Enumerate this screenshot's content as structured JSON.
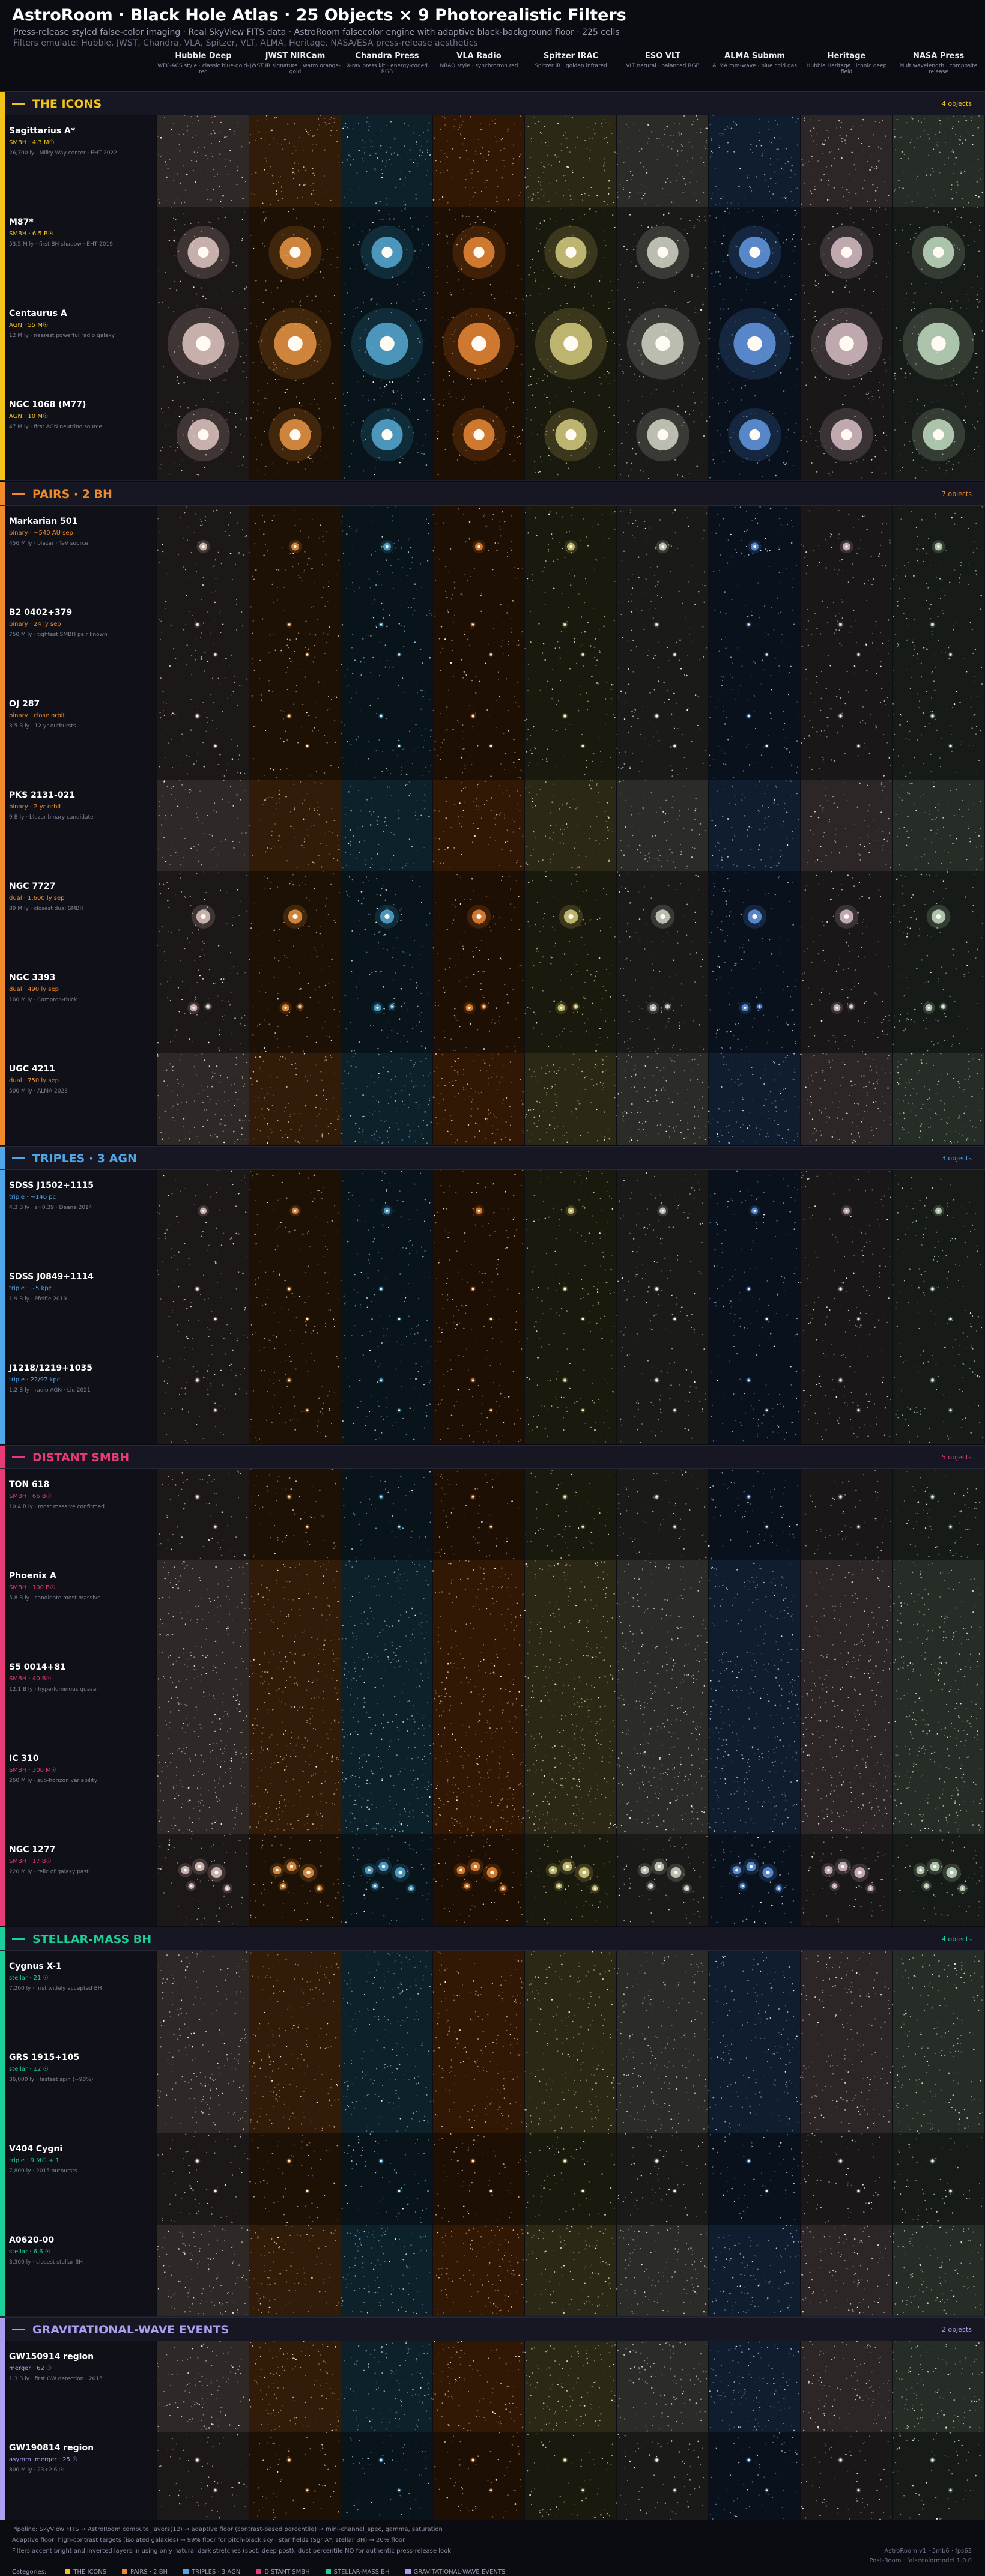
{
  "header": {
    "title": "AstroRoom · Black Hole Atlas · 25 Objects × 9 Photorealistic Filters",
    "subtitle": "Press-release styled false-color imaging · Real SkyView FITS data · AstroRoom falsecolor engine with adaptive black-background floor · 225 cells",
    "subtitle2": "Filters emulate: Hubble, JWST, Chandra, VLA, Spitzer, VLT, ALMA, Heritage, NASA/ESA press-release aesthetics"
  },
  "columns": [
    {
      "name": "Hubble Deep",
      "sub": "WFC-ACS style · classic blue-gold-red",
      "tint": "#e6c7c2"
    },
    {
      "name": "JWST NIRCam",
      "sub": "JWST IR signature · warm orange-gold",
      "tint": "#f08a2a"
    },
    {
      "name": "Chandra Press",
      "sub": "X-ray press kit · energy-coded RGB",
      "tint": "#3fa4d6"
    },
    {
      "name": "VLA Radio",
      "sub": "NRAO style · synchrotron red",
      "tint": "#f07a18"
    },
    {
      "name": "Spitzer IRAC",
      "sub": "Spitzer IR · golden infrared",
      "tint": "#d9cd6e"
    },
    {
      "name": "ESO VLT",
      "sub": "VLT natural · balanced RGB",
      "tint": "#d6d8c6"
    },
    {
      "name": "ALMA Submm",
      "sub": "ALMA mm-wave · blue cold gas",
      "tint": "#4d8fe8"
    },
    {
      "name": "Heritage",
      "sub": "Hubble Heritage · iconic deep field",
      "tint": "#dcbcc4"
    },
    {
      "name": "NASA Press",
      "sub": "Multiwavelength · composite release",
      "tint": "#bfe2bf"
    }
  ],
  "sections": [
    {
      "title": "THE ICONS",
      "count": "4 objects",
      "color": "#f2c318",
      "rows": [
        {
          "name": "Sagittarius A*",
          "type": "SMBH · 4.3 M☉",
          "note": "26,700 ly · Milky Way center · EHT 2022",
          "morph": "field",
          "noise": 0.9
        },
        {
          "name": "M87*",
          "type": "SMBH · 6.5 B☉",
          "note": "53.5 M ly · first BH shadow · EHT 2019",
          "morph": "galaxy",
          "size": 1.0
        },
        {
          "name": "Centaurus A",
          "type": "AGN · 55 M☉",
          "note": "12 M ly · nearest powerful radio galaxy",
          "morph": "galaxy",
          "size": 1.35
        },
        {
          "name": "NGC 1068 (M77)",
          "type": "AGN · 10 M☉",
          "note": "47 M ly · first AGN neutrino source",
          "morph": "galaxy",
          "size": 1.0
        }
      ]
    },
    {
      "title": "PAIRS · 2 BH",
      "count": "7 objects",
      "color": "#f08a2a",
      "rows": [
        {
          "name": "Markarian 501",
          "type": "binary · ~540 AU sep",
          "note": "456 M ly · blazar · TeV source",
          "morph": "point",
          "size": 0.35
        },
        {
          "name": "B2 0402+379",
          "type": "binary · 24 ly sep",
          "note": "750 M ly · tightest SMBH pair known",
          "morph": "sparse",
          "size": 0.25
        },
        {
          "name": "OJ 287",
          "type": "binary · close orbit",
          "note": "3.5 B ly · 12 yr outbursts",
          "morph": "sparse",
          "size": 0.2
        },
        {
          "name": "PKS 2131-021",
          "type": "binary · 2 yr orbit",
          "note": "9 B ly · blazar binary candidate",
          "morph": "field",
          "noise": 0.7
        },
        {
          "name": "NGC 7727",
          "type": "dual · 1,600 ly sep",
          "note": "89 M ly · closest dual SMBH",
          "morph": "galaxy",
          "size": 0.45
        },
        {
          "name": "NGC 3393",
          "type": "dual · 490 ly sep",
          "note": "160 M ly · Compton-thick",
          "morph": "double",
          "size": 0.3
        },
        {
          "name": "UGC 4211",
          "type": "dual · 750 ly sep",
          "note": "500 M ly · ALMA 2023",
          "morph": "field",
          "noise": 1.0
        }
      ]
    },
    {
      "title": "TRIPLES · 3 AGN",
      "count": "3 objects",
      "color": "#4fa6e8",
      "rows": [
        {
          "name": "SDSS J1502+1115",
          "type": "triple · ~140 pc",
          "note": "4.3 B ly · z=0.39 · Deane 2014",
          "morph": "point",
          "size": 0.25
        },
        {
          "name": "SDSS J0849+1114",
          "type": "triple · ~5 kpc",
          "note": "1.9 B ly · Pfeifle 2019",
          "morph": "sparse",
          "size": 0.2
        },
        {
          "name": "J1218/1219+1035",
          "type": "triple · 22/97 kpc",
          "note": "1.2 B ly · radio AGN · Liu 2021",
          "morph": "sparse",
          "size": 0.2
        }
      ]
    },
    {
      "title": "DISTANT SMBH",
      "count": "5 objects",
      "color": "#e83a74",
      "rows": [
        {
          "name": "TON 618",
          "type": "SMBH · 66 B☉",
          "note": "10.4 B ly · most massive confirmed",
          "morph": "sparse",
          "size": 0.2
        },
        {
          "name": "Phoenix A",
          "type": "SMBH · 100 B☉",
          "note": "5.8 B ly · candidate most massive",
          "morph": "field",
          "noise": 0.8
        },
        {
          "name": "S5 0014+81",
          "type": "SMBH · 40 B☉",
          "note": "12.1 B ly · hyperluminous quasar",
          "morph": "field",
          "noise": 1.1
        },
        {
          "name": "IC 310",
          "type": "SMBH · 300 M☉",
          "note": "260 M ly · sub-horizon variability",
          "morph": "field",
          "noise": 1.2
        },
        {
          "name": "NGC 1277",
          "type": "SMBH · 17 B☉",
          "note": "220 M ly · relic of galaxy past",
          "morph": "cluster",
          "size": 0.4
        }
      ]
    },
    {
      "title": "STELLAR-MASS BH",
      "count": "4 objects",
      "color": "#1ad09a",
      "rows": [
        {
          "name": "Cygnus X-1",
          "type": "stellar · 21 ☉",
          "note": "7,200 ly · first widely accepted BH",
          "morph": "field",
          "noise": 0.8
        },
        {
          "name": "GRS 1915+105",
          "type": "stellar · 12 ☉",
          "note": "36,000 ly · fastest spin (~98%)",
          "morph": "field",
          "noise": 0.9
        },
        {
          "name": "V404 Cygni",
          "type": "triple · 9 M☉ + 1",
          "note": "7,800 ly · 2015 outbursts",
          "morph": "sparse",
          "size": 0.15
        },
        {
          "name": "A0620-00",
          "type": "stellar · 6.6 ☉",
          "note": "3,300 ly · closest stellar BH",
          "morph": "field",
          "noise": 1.0
        }
      ]
    },
    {
      "title": "GRAVITATIONAL-WAVE EVENTS",
      "count": "2 objects",
      "color": "#a99ff0",
      "rows": [
        {
          "name": "GW150914 region",
          "type": "merger · 62 ☉",
          "note": "1.3 B ly · first GW detection · 2015",
          "morph": "field",
          "noise": 1.0
        },
        {
          "name": "GW190814 region",
          "type": "asymm. merger · 25 ☉",
          "note": "800 M ly · 23+2.6 ☉",
          "morph": "sparse",
          "size": 0.15
        }
      ]
    }
  ],
  "footer": {
    "line1": "Pipeline: SkyView FITS → AstroRoom compute_layers(12) → adaptive floor (contrast-based percentile) → mini-channel_spec, gamma, saturation",
    "line2": "Adaptive floor: high-contrast targets (isolated galaxies) → 99% floor for pitch-black sky · star fields (Sgr A*, stellar BH) → 20% floor",
    "line3": "Filters accent bright and inverted layers in using only natural dark stretches (spot, deep post), dust percentile NO for authentic press-release look",
    "legend_label": "Categories:",
    "right1": "AstroRoom v1 · 5mb6 · fps63",
    "right2": "Post-Room · falsecolormodel 1.0.0"
  }
}
